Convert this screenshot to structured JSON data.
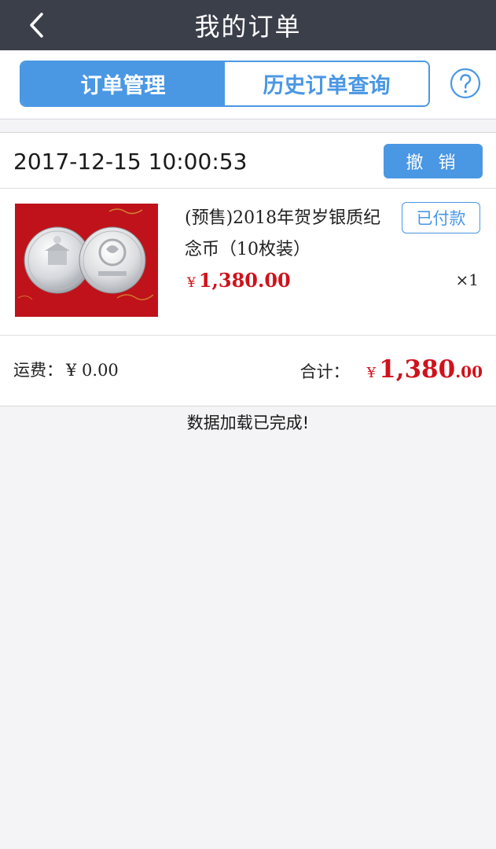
{
  "header": {
    "title": "我的订单",
    "back_icon": "chevron-left-icon"
  },
  "tabs": [
    {
      "label": "订单管理",
      "active": true
    },
    {
      "label": "历史订单查询",
      "active": false
    }
  ],
  "help_icon": "question-circle-icon",
  "order": {
    "time": "2017-12-15 10:00:53",
    "cancel_label": "撤 销",
    "product": {
      "name": "(预售)2018年贺岁银质纪念币（10枚装）",
      "status": "已付款",
      "currency": "¥",
      "price": "1,380.00",
      "quantity": "×1"
    },
    "shipping_label": "运费：",
    "shipping_value": "¥ 0.00",
    "total_label": "合计：",
    "total_currency": "¥",
    "total_integer": "1,380",
    "total_decimal": ".00"
  },
  "load_status": "数据加载已完成!",
  "colors": {
    "accent": "#4a97e4",
    "price": "#d0121b",
    "navbar": "#3b3f4a",
    "background": "#f4f4f6"
  }
}
